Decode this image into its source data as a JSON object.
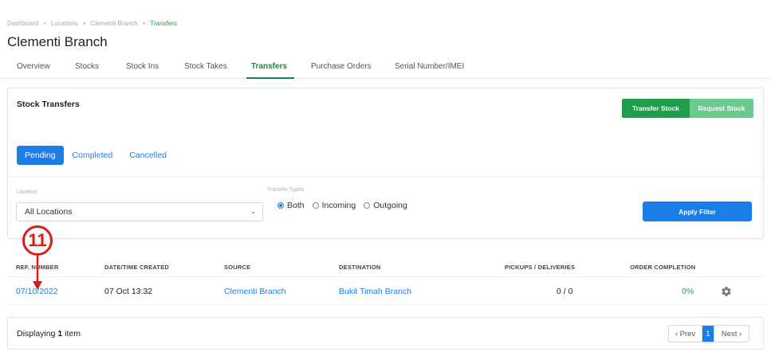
{
  "breadcrumb": {
    "items": [
      "Dashboard",
      "Locations",
      "Clementi Branch"
    ],
    "current": "Transfers"
  },
  "page_title": "Clementi Branch",
  "tabs": [
    {
      "label": "Overview"
    },
    {
      "label": "Stocks"
    },
    {
      "label": "Stock Ins"
    },
    {
      "label": "Stock Takes"
    },
    {
      "label": "Transfers",
      "active": true
    },
    {
      "label": "Purchase Orders"
    },
    {
      "label": "Serial Number/IMEI"
    }
  ],
  "card": {
    "title": "Stock Transfers",
    "transfer_button": "Transfer Stock",
    "request_button": "Request Stock",
    "status_tabs": [
      {
        "label": "Pending",
        "active": true
      },
      {
        "label": "Completed"
      },
      {
        "label": "Cancelled"
      }
    ]
  },
  "filters": {
    "location_label": "Location",
    "location_value": "All Locations",
    "transfer_types_label": "Transfer Types",
    "transfer_types": [
      {
        "label": "Both",
        "selected": true
      },
      {
        "label": "Incoming",
        "selected": false
      },
      {
        "label": "Outgoing",
        "selected": false
      }
    ],
    "apply_button": "Apply Filter"
  },
  "table": {
    "headers": [
      "REF. NUMBER",
      "DATE/TIME CREATED",
      "SOURCE",
      "DESTINATION",
      "PICKUPS / DELIVERIES",
      "ORDER COMPLETION"
    ],
    "rows": [
      {
        "ref_number": "07/10/2022",
        "created": "07 Oct 13:32",
        "source": "Clementi Branch",
        "destination": "Bukit Timah Branch",
        "pickups_deliveries": "0 / 0",
        "order_completion": "0%",
        "action_icon": "gear-icon"
      }
    ]
  },
  "footer": {
    "displaying_prefix": "Displaying",
    "count": "1",
    "displaying_suffix": "item",
    "prev": "‹ Prev",
    "page": "1",
    "next": "Next ›"
  },
  "annotation": {
    "number": "11"
  },
  "colors": {
    "green": "#1e9e4a",
    "green_light": "#6ec98e",
    "blue": "#1a7ee8",
    "annotation_red": "#e01818"
  }
}
